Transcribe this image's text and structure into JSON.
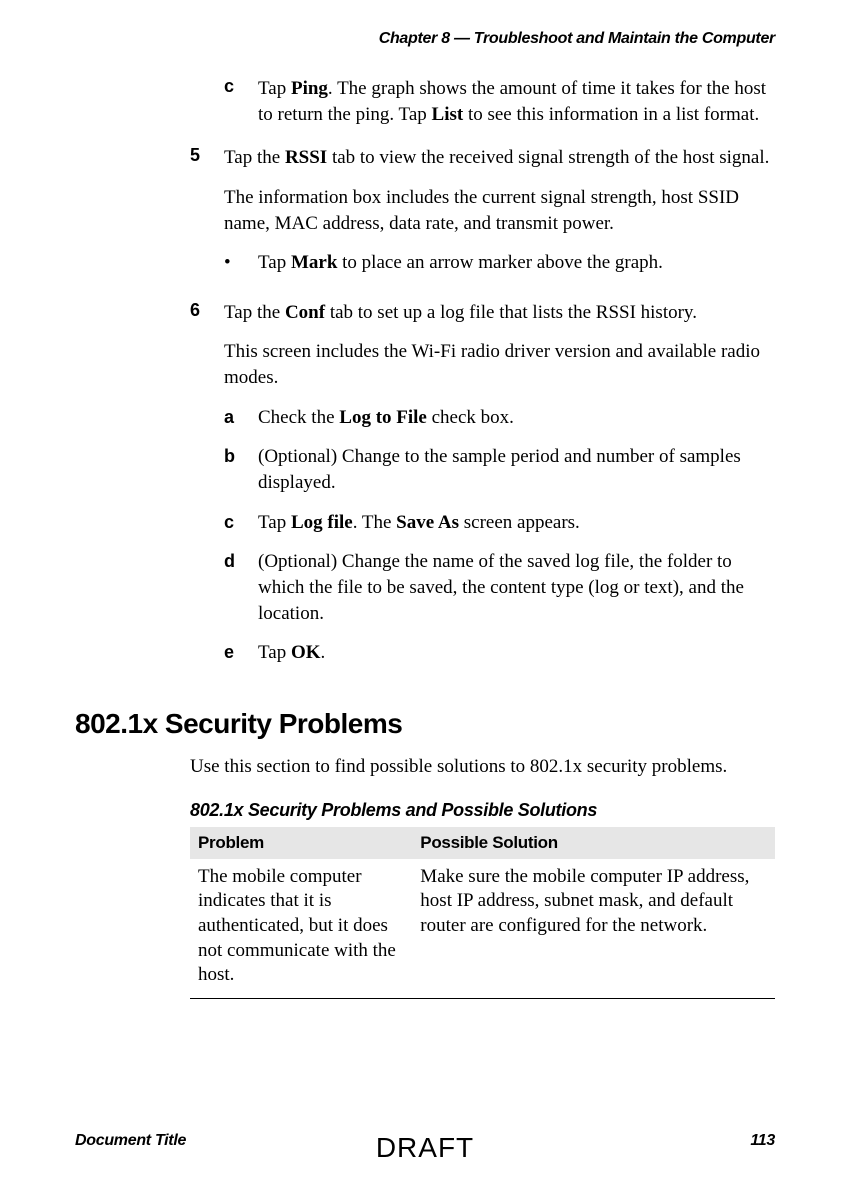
{
  "chapter_header": "Chapter 8 — Troubleshoot and Maintain the Computer",
  "step4c": {
    "marker": "c",
    "text_pre": "Tap ",
    "bold1": "Ping",
    "text_mid": ". The graph shows the amount of time it takes for the host to return the ping. Tap ",
    "bold2": "List",
    "text_post": " to see this information in a list format."
  },
  "step5": {
    "marker": "5",
    "line1_pre": "Tap the ",
    "line1_bold": "RSSI",
    "line1_post": " tab to view the received signal strength of the host signal.",
    "para2": "The information box includes the current signal strength, host SSID name, MAC address, data rate, and transmit power.",
    "bullet_pre": "Tap ",
    "bullet_bold": "Mark",
    "bullet_post": " to place an arrow marker above the graph."
  },
  "step6": {
    "marker": "6",
    "line1_pre": "Tap the ",
    "line1_bold": "Conf",
    "line1_post": " tab to set up a log file that lists the RSSI history.",
    "para2": "This screen includes the Wi-Fi radio driver version and available radio modes.",
    "a": {
      "marker": "a",
      "pre": "Check the ",
      "bold": "Log to File",
      "post": " check box."
    },
    "b": {
      "marker": "b",
      "text": "(Optional) Change to the sample period and number of samples displayed."
    },
    "c": {
      "marker": "c",
      "pre": "Tap ",
      "bold1": "Log file",
      "mid": ". The ",
      "bold2": "Save As",
      "post": " screen appears."
    },
    "d": {
      "marker": "d",
      "text": "(Optional) Change the name of the saved log file, the folder to which the file to be saved, the content type (log or text), and the location."
    },
    "e": {
      "marker": "e",
      "pre": "Tap ",
      "bold": "OK",
      "post": "."
    }
  },
  "section_heading": "802.1x Security Problems",
  "section_intro": "Use this section to find possible solutions to 802.1x security problems.",
  "table_title": "802.1x Security Problems and Possible Solutions",
  "table": {
    "header_problem": "Problem",
    "header_solution": "Possible Solution",
    "row1_problem": "The mobile computer indicates that it is authenticated, but it does not communicate with the host.",
    "row1_solution": "Make sure the mobile computer IP address, host IP address, subnet mask, and default router are configured for the network."
  },
  "footer": {
    "left": "Document Title",
    "center": "DRAFT",
    "right": "113"
  }
}
